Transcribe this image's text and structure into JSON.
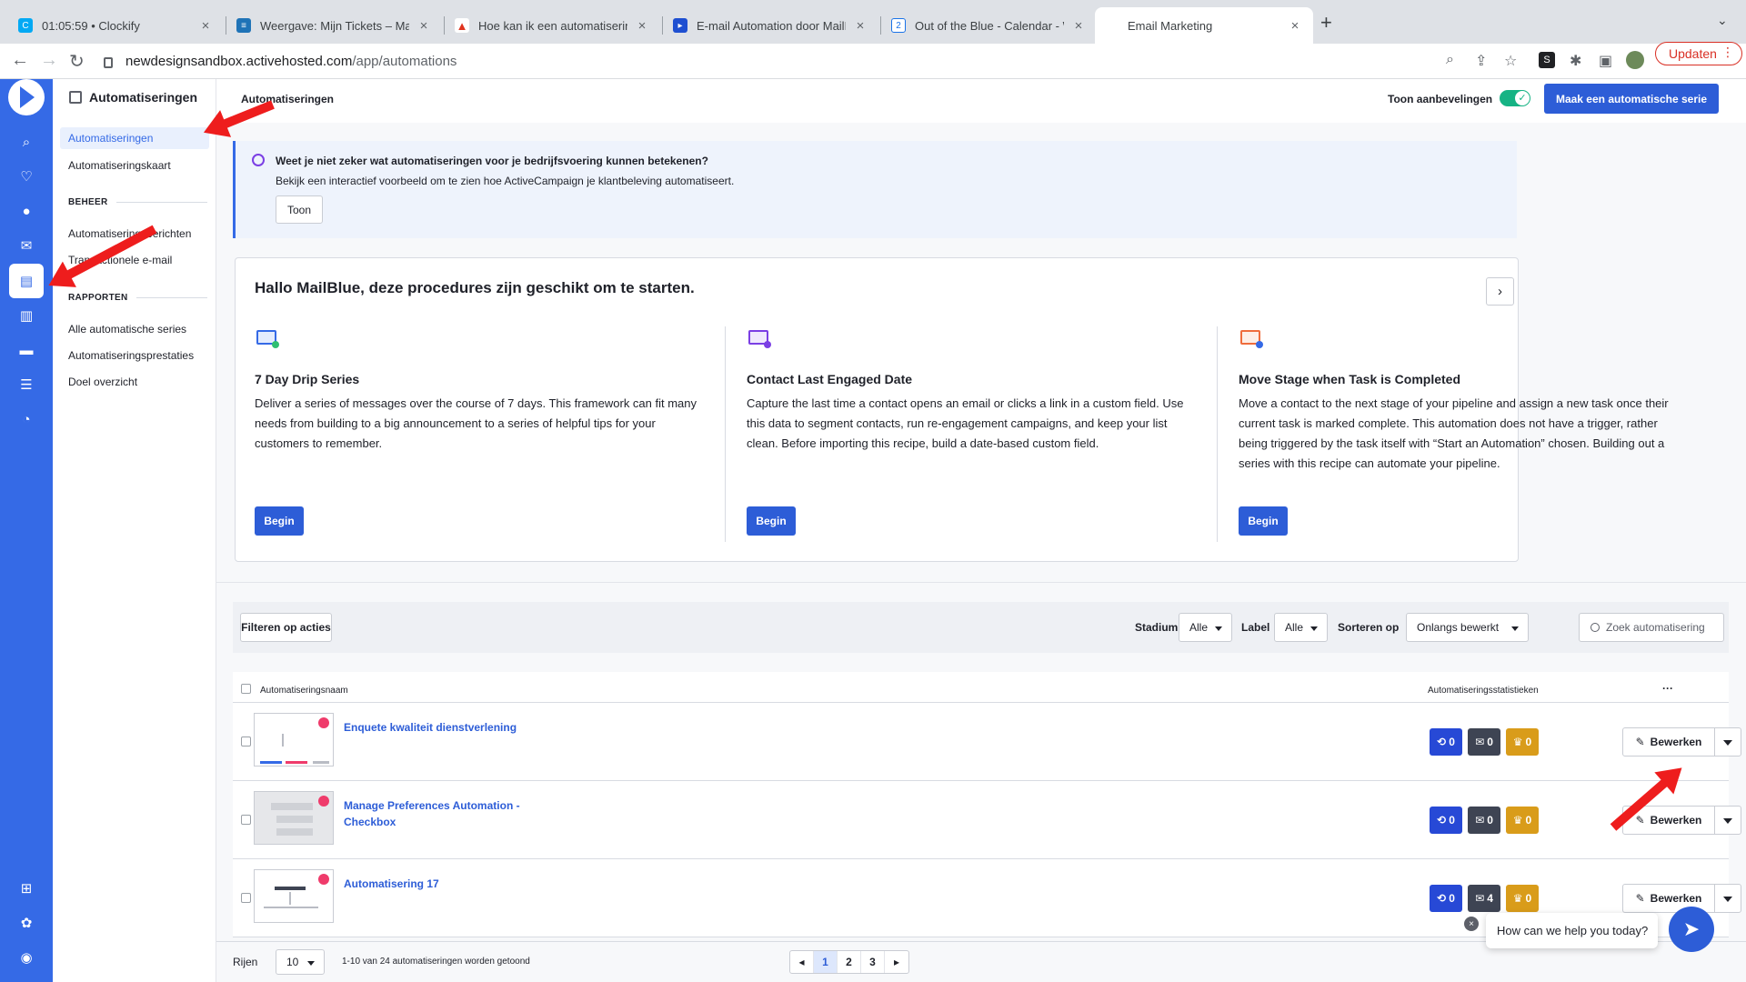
{
  "browser": {
    "tabs": [
      {
        "title": "01:05:59 • Clockify",
        "color": "#03a9f4",
        "glyph": "C"
      },
      {
        "title": "Weergave: Mijn Tickets – MailB",
        "color": "#1f73b7",
        "glyph": "≡"
      },
      {
        "title": "Hoe kan ik een automatisering",
        "color": "#e0341f",
        "glyph": "▲"
      },
      {
        "title": "E-mail Automation door MailBlu",
        "color": "#1e4fd1",
        "glyph": "▸"
      },
      {
        "title": "Out of the Blue - Calendar - W",
        "color": "#1a73e8",
        "glyph": "2"
      },
      {
        "title": "Email Marketing",
        "color": "",
        "glyph": ""
      }
    ],
    "url_host": "newdesignsandbox.activehosted.com",
    "url_path": "/app/automations",
    "update_label": "Updaten"
  },
  "rail": {
    "icons": [
      "search-icon",
      "lightbulb-icon",
      "contacts-icon",
      "campaigns-icon",
      "automations-icon",
      "pipeline-icon",
      "conversations-icon",
      "website-icon",
      "reports-icon",
      "apps-icon",
      "settings-icon",
      "user-icon"
    ]
  },
  "subnav": {
    "title": "Automatiseringen",
    "items": [
      "Automatiseringen",
      "Automatiseringskaart"
    ],
    "section1": "BEHEER",
    "section1_items": [
      "Automatiseringsberichten",
      "Transactionele e-mail"
    ],
    "section2": "RAPPORTEN",
    "section2_items": [
      "Alle automatische series",
      "Automatiseringsprestaties",
      "Doel overzicht"
    ]
  },
  "header": {
    "title": "Automatiseringen",
    "toggle_label": "Toon aanbevelingen",
    "toggle_on": true,
    "create_button": "Maak een automatische serie"
  },
  "banner": {
    "question": "Weet je niet zeker wat automatiseringen voor je bedrijfsvoering kunnen betekenen?",
    "text": "Bekijk een interactief voorbeeld om te zien hoe ActiveCampaign je klantbeleving automatiseert.",
    "button": "Toon"
  },
  "recipes": {
    "title": "Hallo MailBlue, deze procedures zijn geschikt om te starten.",
    "items": [
      {
        "name": "7 Day Drip Series",
        "desc": "Deliver a series of messages over the course of 7 days. This framework can fit many needs from building to a big announcement to a series of helpful tips for your customers to remember.",
        "button": "Begin"
      },
      {
        "name": "Contact Last Engaged Date",
        "desc": "Capture the last time a contact opens an email or clicks a link in a custom field. Use this data to segment contacts, run re-engagement campaigns, and keep your list clean. Before importing this recipe, build a date-based custom field.",
        "button": "Begin"
      },
      {
        "name": "Move Stage when Task is Completed",
        "desc": "Move a contact to the next stage of your pipeline and assign a new task once their current task is marked complete. This automation does not have a trigger, rather being triggered by the task itself with “Start an Automation” chosen. Building out a series with this recipe can automate your pipeline.",
        "button": "Begin"
      }
    ]
  },
  "filters": {
    "filter_button": "Filteren op acties",
    "stage_label": "Stadium",
    "stage_value": "Alle",
    "label_label": "Label",
    "label_value": "Alle",
    "sort_label": "Sorteren op",
    "sort_value": "Onlangs bewerkt",
    "search_placeholder": "Zoek automatisering"
  },
  "table": {
    "col_name": "Automatiseringsnaam",
    "col_stats": "Automatiseringsstatistieken",
    "more": "···",
    "rows": [
      {
        "name": "Enquete kwaliteit dienstverlening",
        "contacts": "0",
        "emails": "0",
        "goals": "0",
        "edit": "Bewerken"
      },
      {
        "name": "Manage Preferences Automation - Checkbox",
        "contacts": "0",
        "emails": "0",
        "goals": "0",
        "edit": "Bewerken"
      },
      {
        "name": "Automatisering 17",
        "contacts": "0",
        "emails": "4",
        "goals": "0",
        "edit": "Bewerken"
      }
    ]
  },
  "footer": {
    "rows_label": "Rijen",
    "rows_value": "10",
    "count_text": "1-10 van 24 automatiseringen worden getoond",
    "pages": [
      "1",
      "2",
      "3"
    ],
    "current_page": "1"
  },
  "chat": {
    "text": "How can we help you today?"
  },
  "colors": {
    "brand": "#356ae6",
    "primary_button": "#2d5dd7",
    "annotation_arrow": "#ee1d1d"
  }
}
